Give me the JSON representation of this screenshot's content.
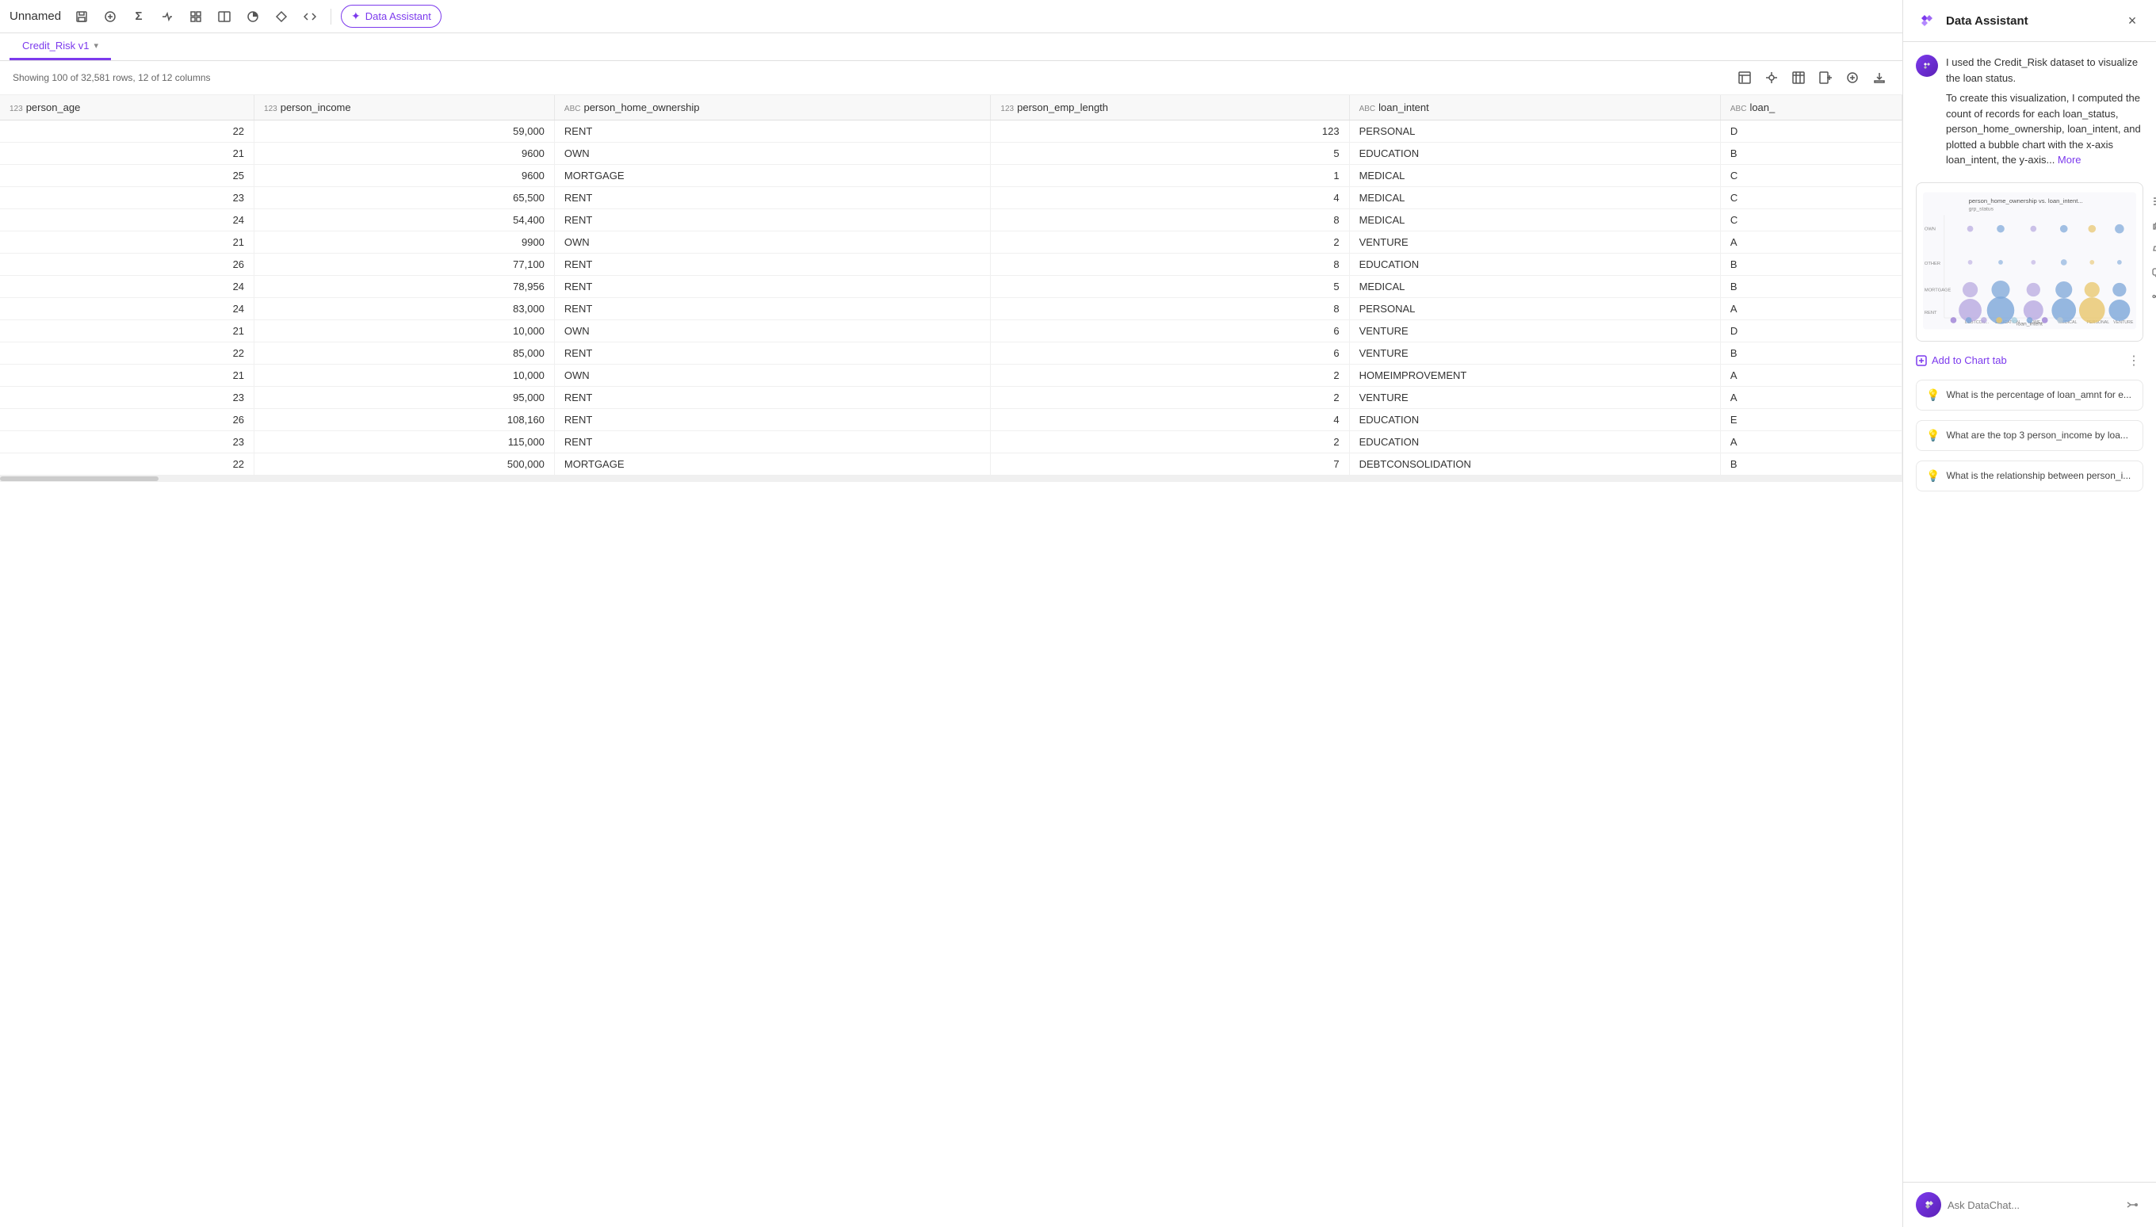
{
  "toolbar": {
    "title": "Unnamed",
    "data_assistant_label": "Data Assistant"
  },
  "tab": {
    "name": "Credit_Risk v1",
    "arrow": "▾"
  },
  "dataset_info": {
    "summary": "Showing 100 of 32,581 rows, 12 of 12 columns"
  },
  "table": {
    "columns": [
      {
        "type": "123",
        "name": "person_age"
      },
      {
        "type": "123",
        "name": "person_income"
      },
      {
        "type": "ABC",
        "name": "person_home_ownership"
      },
      {
        "type": "123",
        "name": "person_emp_length"
      },
      {
        "type": "ABC",
        "name": "loan_intent"
      },
      {
        "type": "ABC",
        "name": "loan_"
      }
    ],
    "rows": [
      [
        22,
        "59,000",
        "RENT",
        123,
        "PERSONAL",
        "D"
      ],
      [
        21,
        "9600",
        "OWN",
        5,
        "EDUCATION",
        "B"
      ],
      [
        25,
        "9600",
        "MORTGAGE",
        1,
        "MEDICAL",
        "C"
      ],
      [
        23,
        "65,500",
        "RENT",
        4,
        "MEDICAL",
        "C"
      ],
      [
        24,
        "54,400",
        "RENT",
        8,
        "MEDICAL",
        "C"
      ],
      [
        21,
        "9900",
        "OWN",
        2,
        "VENTURE",
        "A"
      ],
      [
        26,
        "77,100",
        "RENT",
        8,
        "EDUCATION",
        "B"
      ],
      [
        24,
        "78,956",
        "RENT",
        5,
        "MEDICAL",
        "B"
      ],
      [
        24,
        "83,000",
        "RENT",
        8,
        "PERSONAL",
        "A"
      ],
      [
        21,
        "10,000",
        "OWN",
        6,
        "VENTURE",
        "D"
      ],
      [
        22,
        "85,000",
        "RENT",
        6,
        "VENTURE",
        "B"
      ],
      [
        21,
        "10,000",
        "OWN",
        2,
        "HOMEIMPROVEMENT",
        "A"
      ],
      [
        23,
        "95,000",
        "RENT",
        2,
        "VENTURE",
        "A"
      ],
      [
        26,
        "108,160",
        "RENT",
        4,
        "EDUCATION",
        "E"
      ],
      [
        23,
        "115,000",
        "RENT",
        2,
        "EDUCATION",
        "A"
      ],
      [
        22,
        "500,000",
        "MORTGAGE",
        7,
        "DEBTCONSOLIDATION",
        "B"
      ]
    ]
  },
  "assistant": {
    "title": "Data Assistant",
    "close_label": "×",
    "message1": "I used the Credit_Risk dataset to visualize the loan status.",
    "message2": "To create this visualization, I computed the count of records for each loan_status, person_home_ownership, loan_intent, and plotted a bubble chart with the x-axis loan_intent, the y-axis...",
    "more_link": "More",
    "add_to_chart_label": "Add to Chart tab",
    "suggestions": [
      "What is the percentage of loan_amnt for e...",
      "What are the top 3 person_income by loa...",
      "What is the relationship between person_i..."
    ],
    "input_placeholder": "Ask DataChat...",
    "chart_title": "person_home_ownership vs. loan_intent...",
    "chart_subtitle": "grp_status"
  }
}
